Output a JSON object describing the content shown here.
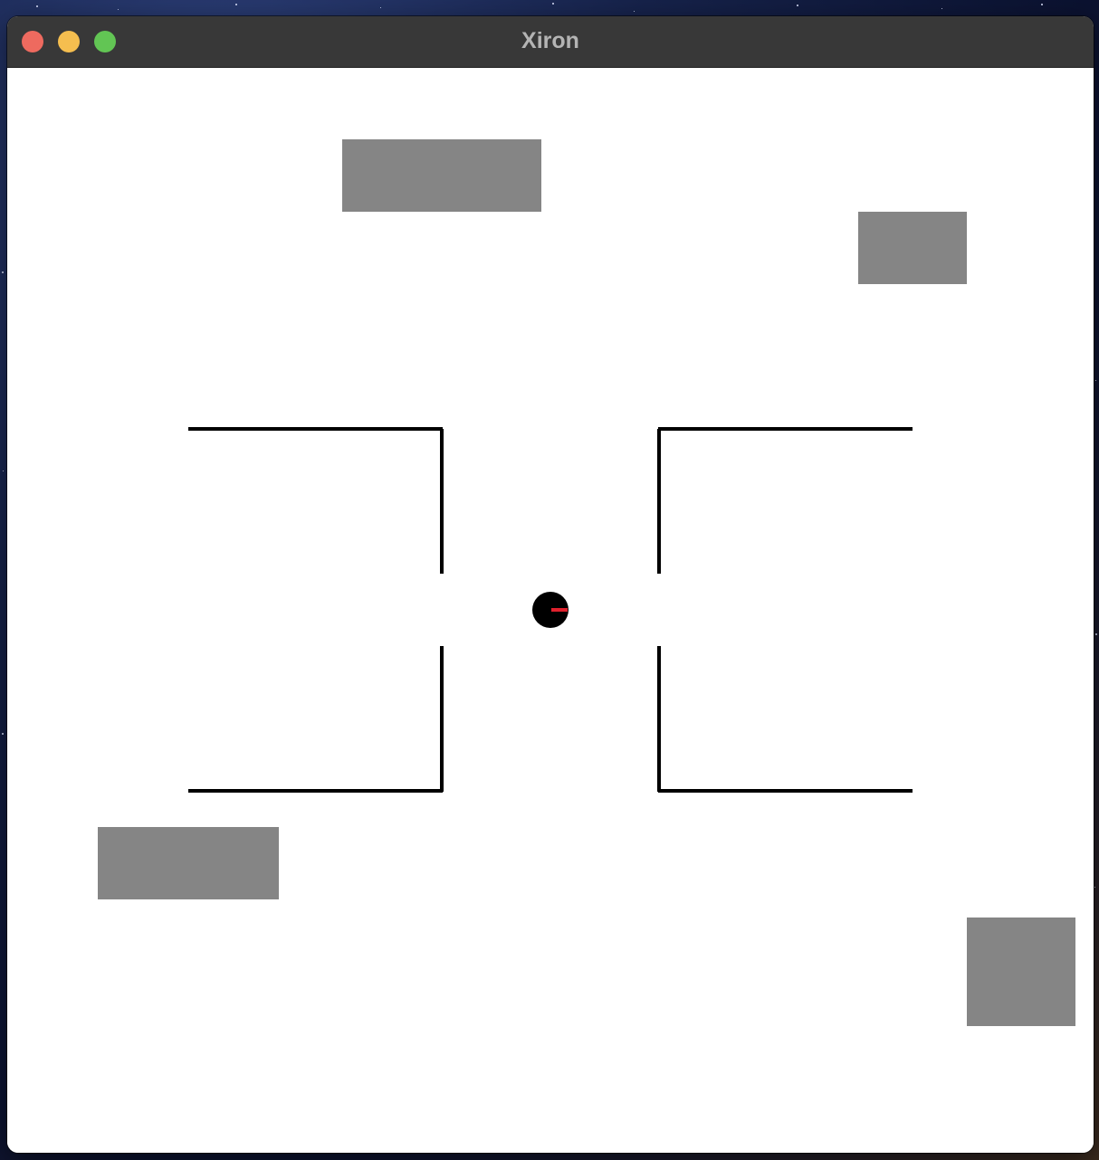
{
  "window": {
    "title": "Xiron",
    "controls": {
      "close_color": "#ee6a5f",
      "minimize_color": "#f5be4f",
      "zoom_color": "#62c554"
    }
  },
  "simulation": {
    "background_color": "#ffffff",
    "obstacle_color": "#858585",
    "wall_color": "#000000",
    "robot_color": "#000000",
    "robot_heading_color": "#e0212d",
    "obstacle_count": 4,
    "wall_segment_count": 8,
    "robot_heading": "east"
  }
}
